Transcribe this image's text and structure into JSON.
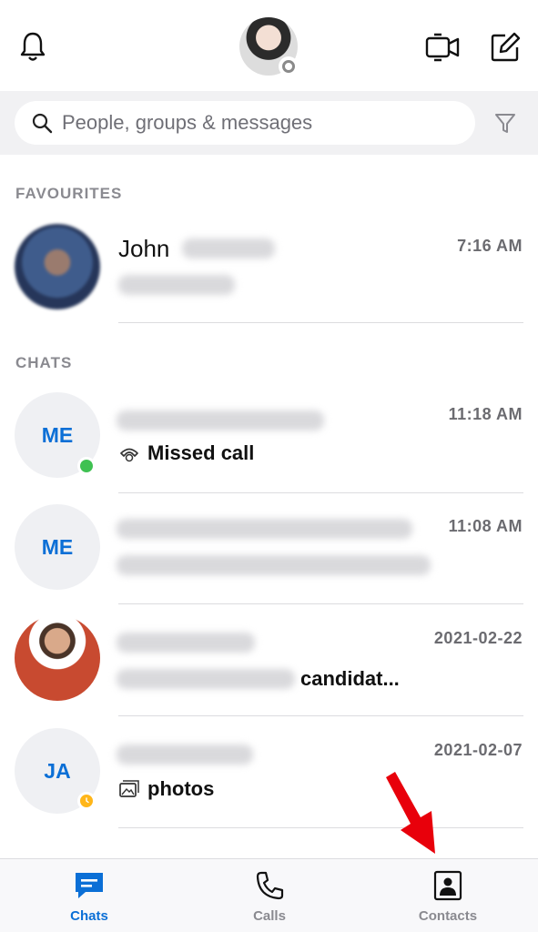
{
  "header": {
    "bell_icon": "bell-icon",
    "video_icon": "video-call-icon",
    "compose_icon": "compose-icon"
  },
  "search": {
    "placeholder": "People, groups & messages"
  },
  "favourites": {
    "label": "FAVOURITES",
    "items": [
      {
        "name": "John",
        "time": "7:16 AM"
      }
    ]
  },
  "chats": {
    "label": "CHATS",
    "items": [
      {
        "initials": "ME",
        "time": "11:18 AM",
        "preview": "Missed call",
        "preview_icon": "missed-call-icon",
        "status": "online"
      },
      {
        "initials": "ME",
        "time": "11:08 AM"
      },
      {
        "time": "2021-02-22",
        "preview": "candidat..."
      },
      {
        "initials": "JA",
        "time": "2021-02-07",
        "preview": "photos",
        "preview_icon": "photos-icon",
        "status": "away"
      }
    ]
  },
  "tabs": [
    {
      "label": "Chats",
      "icon": "chat-icon",
      "active": true
    },
    {
      "label": "Calls",
      "icon": "phone-icon"
    },
    {
      "label": "Contacts",
      "icon": "contacts-icon"
    }
  ],
  "colors": {
    "accent": "#0b6fd6",
    "online": "#3fc152",
    "away": "#ffb619",
    "annotation_arrow": "#e8000b"
  }
}
